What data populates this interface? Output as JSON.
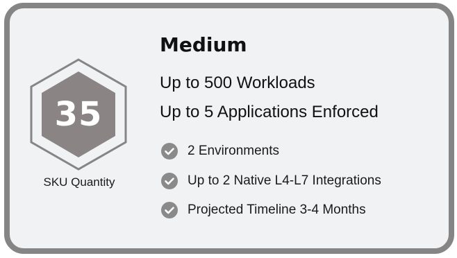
{
  "sku": {
    "quantity": "35",
    "label": "SKU Quantity"
  },
  "plan": {
    "title": "Medium",
    "headlines": [
      "Up to 500 Workloads",
      "Up to 5 Applications Enforced"
    ],
    "features": [
      {
        "icon": "check-circle-icon",
        "label": "2 Environments"
      },
      {
        "icon": "check-circle-icon",
        "label": "Up to 2 Native L4-L7 Integrations"
      },
      {
        "icon": "check-circle-icon",
        "label": "Projected Timeline 3-4 Months"
      }
    ]
  },
  "colors": {
    "card_border": "#858585",
    "card_background": "#f1f2f4",
    "hex_outline": "#858585",
    "hex_fill": "#8a8484",
    "check_fill": "#8a8a8a",
    "text": "#111111"
  }
}
